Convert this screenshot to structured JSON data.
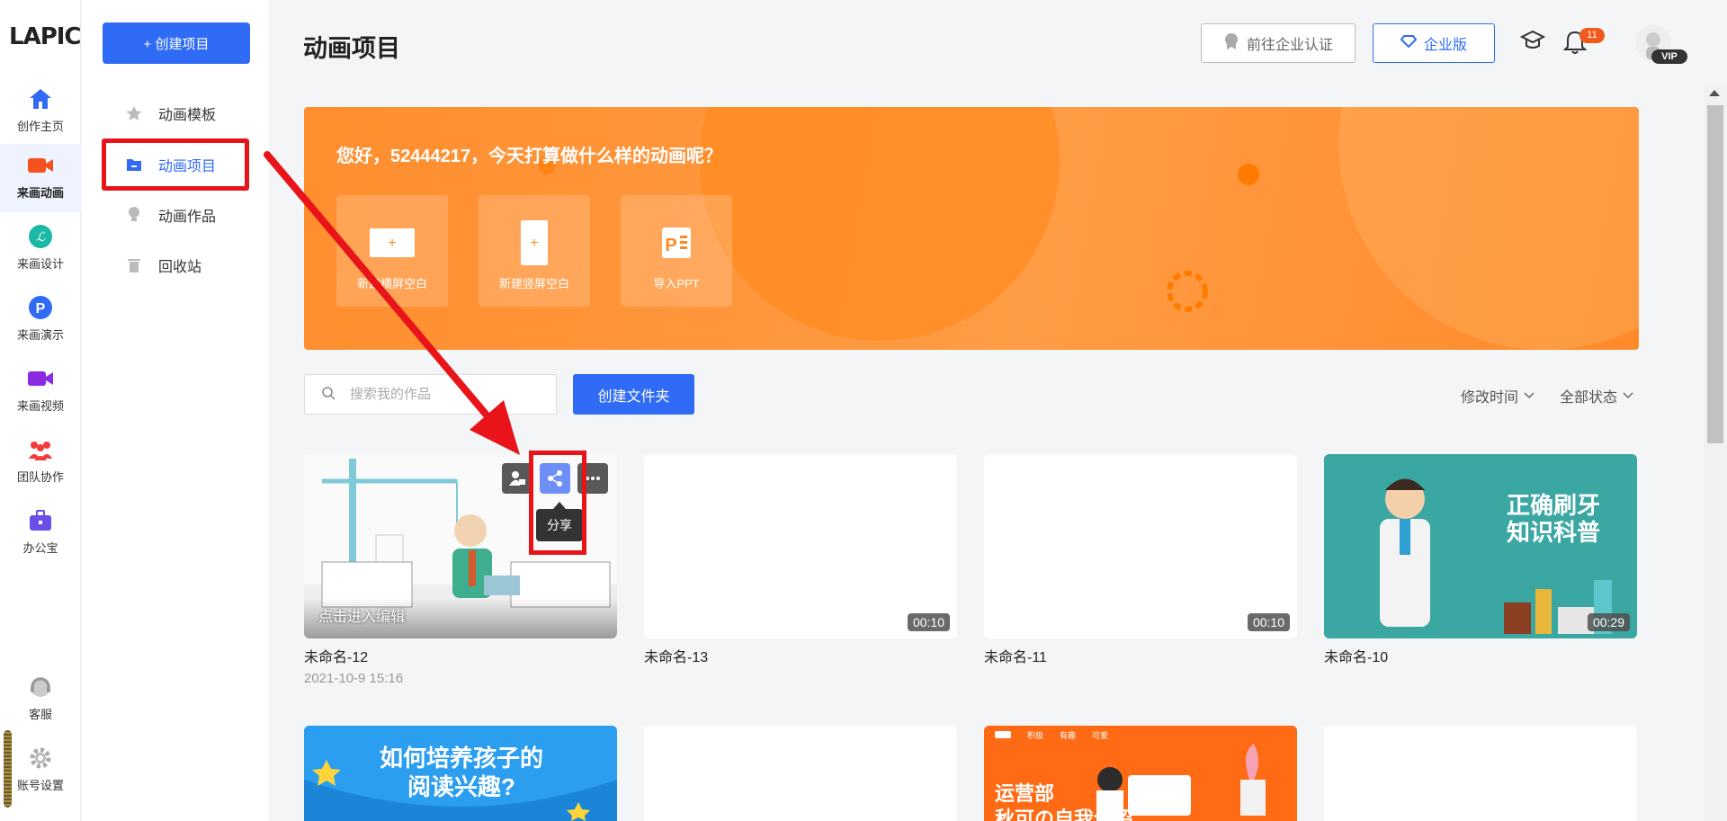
{
  "logo": "LAPIC",
  "rail": {
    "items": [
      {
        "label": "创作主页"
      },
      {
        "label": "来画动画"
      },
      {
        "label": "来画设计"
      },
      {
        "label": "来画演示"
      },
      {
        "label": "来画视频"
      },
      {
        "label": "团队协作"
      },
      {
        "label": "办公宝"
      },
      {
        "label": "客服"
      },
      {
        "label": "账号设置"
      }
    ],
    "active_index": 1
  },
  "sidebar": {
    "create_label": "+ 创建项目",
    "items": [
      {
        "label": "动画模板",
        "icon": "star-icon"
      },
      {
        "label": "动画项目",
        "icon": "folder-icon"
      },
      {
        "label": "动画作品",
        "icon": "bulb-icon"
      },
      {
        "label": "回收站",
        "icon": "trash-icon"
      }
    ],
    "active_index": 1
  },
  "header": {
    "title": "动画项目",
    "cert_label": "前往企业认证",
    "enterprise_label": "企业版",
    "notif_count": "11",
    "vip": "VIP"
  },
  "banner": {
    "greeting": "您好，52444217，今天打算做什么样的动画呢？",
    "actions": [
      {
        "label": "新建横屏空白",
        "icon": "landscape-blank-icon"
      },
      {
        "label": "新建竖屏空白",
        "icon": "portrait-blank-icon"
      },
      {
        "label": "导入PPT",
        "icon": "ppt-icon"
      }
    ]
  },
  "toolbar": {
    "search_placeholder": "搜索我的作品",
    "create_folder_label": "创建文件夹",
    "sort_time": "修改时间",
    "sort_status": "全部状态"
  },
  "projects": [
    {
      "name": "未命名-12",
      "date": "2021-10-9 15:16",
      "edit_hint": "点击进入编辑"
    },
    {
      "name": "未命名-13",
      "duration": "00:10"
    },
    {
      "name": "未命名-11",
      "duration": "00:10"
    },
    {
      "name": "未命名-10",
      "duration": "00:29",
      "thumb_text_1": "正确刷牙",
      "thumb_text_2": "知识科普"
    }
  ],
  "row2": {
    "card1_text_1": "如何培养孩子的",
    "card1_text_2": "阅读兴趣?",
    "card3_text_1": "运营部",
    "card3_text_2": "秋可の自我介绍",
    "card3_nav": [
      "积极",
      "有趣",
      "可爱"
    ]
  },
  "tooltip": {
    "share": "分享"
  },
  "colors": {
    "primary": "#2f6bf5",
    "banner": "#ff9434",
    "highlight": "#e8141a"
  }
}
